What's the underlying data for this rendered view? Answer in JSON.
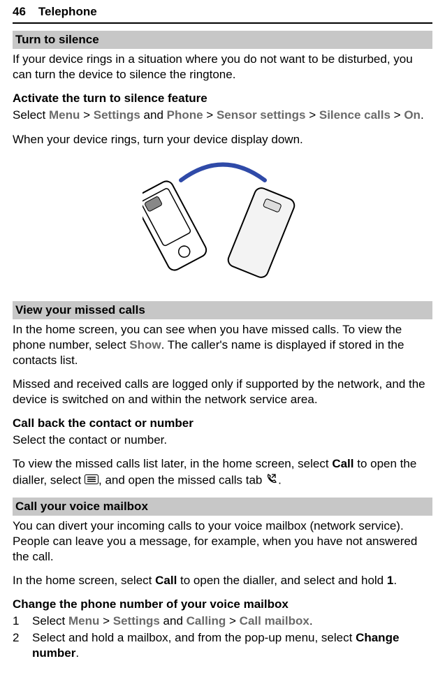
{
  "header": {
    "page_number": "46",
    "chapter": "Telephone"
  },
  "sec1": {
    "title": "Turn to silence",
    "intro": "If your device rings in a situation where you do not want to be disturbed, you can turn the device to silence the ringtone.",
    "activate_hdr": "Activate the turn to silence feature",
    "activate_prefix": "Select ",
    "nav1_menu": "Menu",
    "nav1_gt1": " > ",
    "nav1_settings": "Settings",
    "nav1_and": " and ",
    "nav1_phone": "Phone",
    "nav1_gt2": " > ",
    "nav1_sensor": "Sensor settings",
    "nav1_gt3": " > ",
    "nav1_silence": "Silence calls",
    "nav1_gt4": " > ",
    "nav1_on": "On",
    "nav1_period": ".",
    "turn_note": "When your device rings, turn your device display down."
  },
  "sec2": {
    "title": "View your missed calls",
    "p1_a": "In the home screen, you can see when you have missed calls. To view the phone number, select ",
    "p1_show": "Show",
    "p1_b": ". The caller's name is displayed if stored in the contacts list.",
    "p2": "Missed and received calls are logged only if supported by the network, and the device is switched on and within the network service area.",
    "cb_hdr": "Call back the contact or number",
    "cb_body": "Select the contact or number.",
    "later_a": "To view the missed calls list later, in the home screen, select ",
    "later_call": "Call",
    "later_b": " to open the dialler, select ",
    "later_c": ", and open the missed calls tab ",
    "later_d": "."
  },
  "sec3": {
    "title": "Call your voice mailbox",
    "p1": "You can divert your incoming calls to your voice mailbox (network service). People can leave you a message, for example, when you have not answered the call.",
    "p2_a": "In the home screen, select ",
    "p2_call": "Call",
    "p2_b": " to open the dialler, and select and hold ",
    "p2_one": "1",
    "p2_c": ".",
    "change_hdr": "Change the phone number of your voice mailbox",
    "step1_num": "1",
    "step1_a": "Select ",
    "step1_menu": "Menu",
    "step1_gt1": " > ",
    "step1_settings": "Settings",
    "step1_and": " and ",
    "step1_calling": "Calling",
    "step1_gt2": " > ",
    "step1_callmailbox": "Call mailbox",
    "step1_period": ".",
    "step2_num": "2",
    "step2_a": "Select and hold a mailbox, and from the pop-up menu, select ",
    "step2_change": "Change number",
    "step2_period": "."
  }
}
